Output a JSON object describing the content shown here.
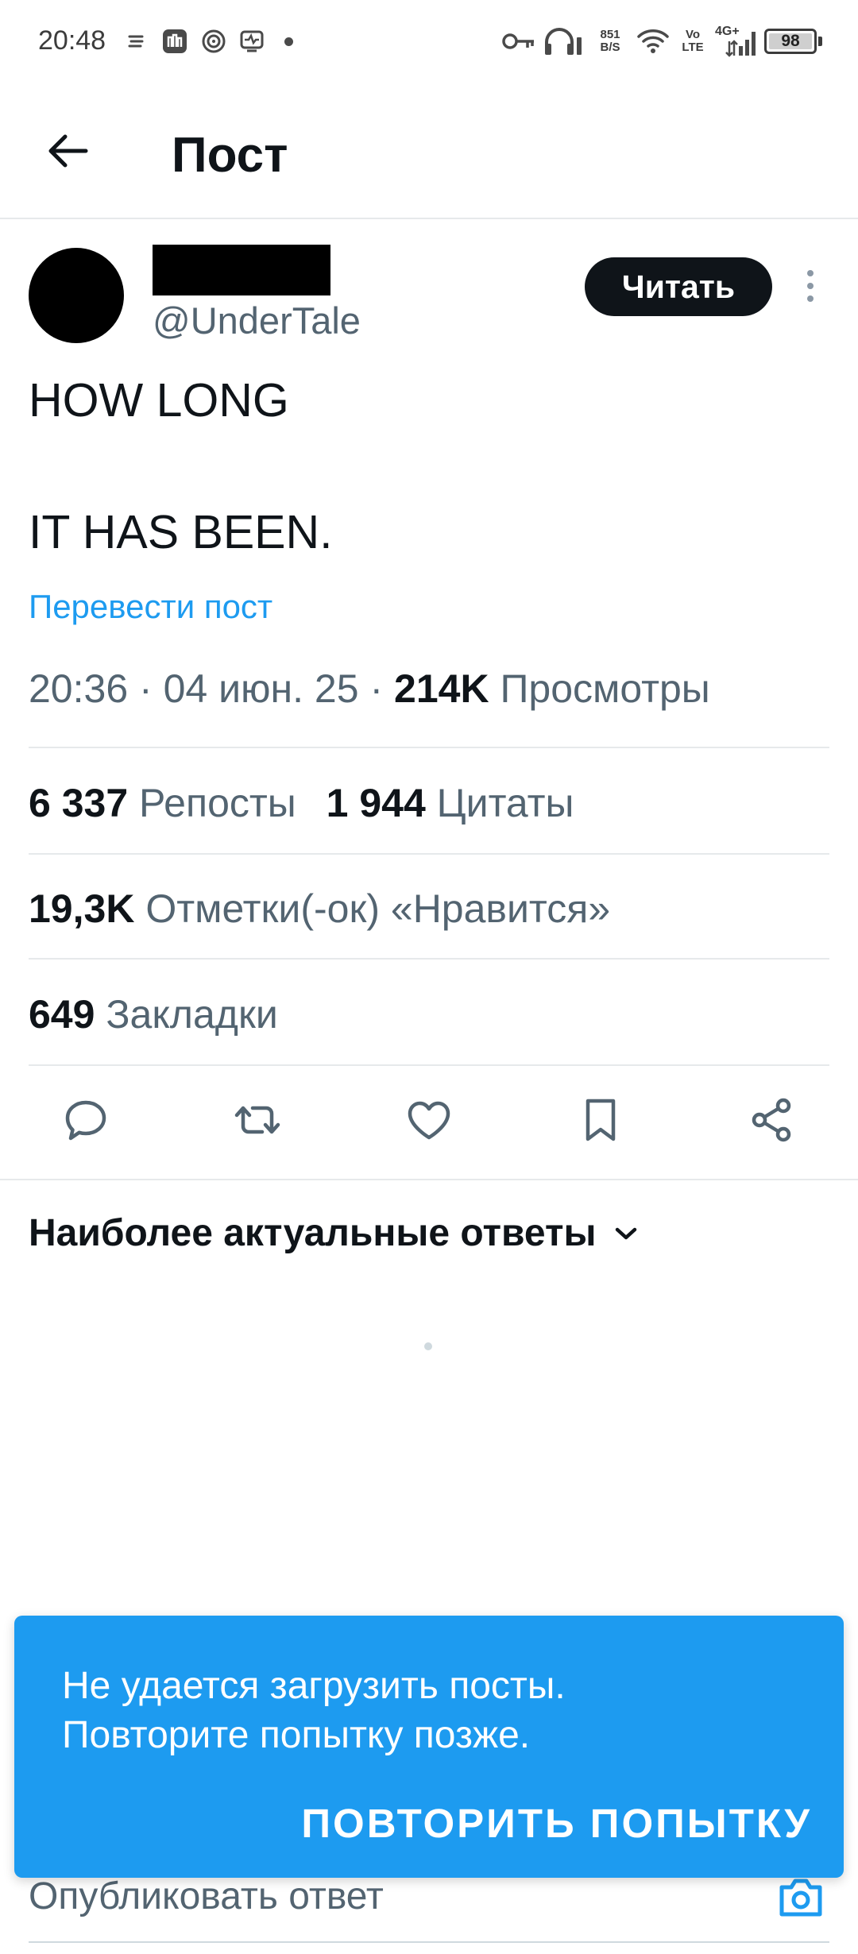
{
  "status_bar": {
    "time": "20:48",
    "net_speed_value": "851",
    "net_speed_unit": "B/S",
    "volte_top": "Vo",
    "volte_bottom": "LTE",
    "network": "4G+",
    "battery": "98"
  },
  "header": {
    "title": "Пост"
  },
  "post": {
    "handle": "@UnderTale",
    "follow_label": "Читать",
    "text_line1": "HOW LONG",
    "text_line2": "IT HAS BEEN.",
    "translate_label": "Перевести пост",
    "time": "20:36",
    "date": "04 июн. 25",
    "separator": "·",
    "views_count": "214K",
    "views_label": "Просмотры",
    "reposts_count": "6 337",
    "reposts_label": "Репосты",
    "quotes_count": "1 944",
    "quotes_label": "Цитаты",
    "likes_count": "19,3K",
    "likes_label": "Отметки(-ок) «Нравится»",
    "bookmarks_count": "649",
    "bookmarks_label": "Закладки"
  },
  "actions": {
    "icons": [
      "reply-icon",
      "repost-icon",
      "like-icon",
      "bookmark-icon",
      "share-icon"
    ]
  },
  "replies": {
    "sort_label": "Наиболее актуальные ответы"
  },
  "snackbar": {
    "message_line1": "Не удается загрузить посты.",
    "message_line2": "Повторите попытку позже.",
    "action_label": "ПОВТОРИТЬ ПОПЫТКУ"
  },
  "composer": {
    "placeholder": "Опубликовать ответ"
  },
  "colors": {
    "accent": "#1d9bf0",
    "text_primary": "#0f1419",
    "text_secondary": "#536471"
  }
}
